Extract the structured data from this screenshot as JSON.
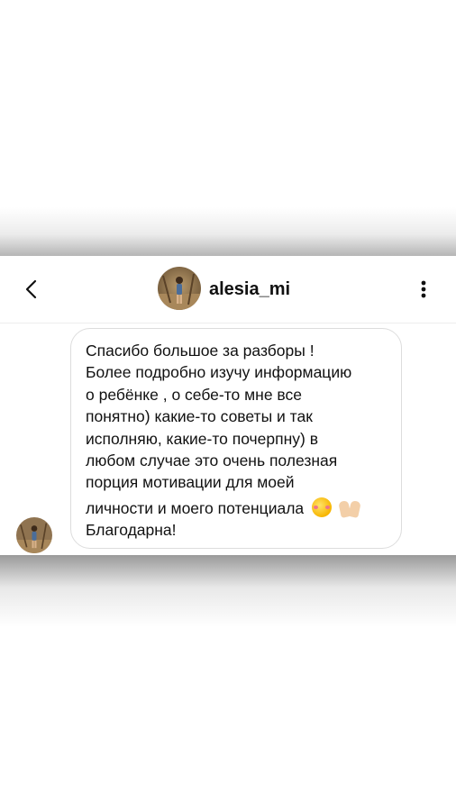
{
  "header": {
    "username": "alesia_mi",
    "back_icon": "chevron-left-icon",
    "more_icon": "more-vertical-icon"
  },
  "message": {
    "lines": [
      "Спасибо большое за разборы !",
      "Более подробно изучу информацию",
      "о ребёнке , о себе-то мне все",
      "понятно) какие-то советы и так",
      "исполняю, какие-то почерпну) в",
      "любом случае это очень полезная",
      "порция мотивации для моей",
      "личности и моего потенциала",
      "Благодарна!"
    ],
    "emojis": [
      "smiling-face-with-hearts",
      "raising-hands"
    ]
  },
  "colors": {
    "bubble_border": "#dddddd",
    "text": "#111111"
  }
}
